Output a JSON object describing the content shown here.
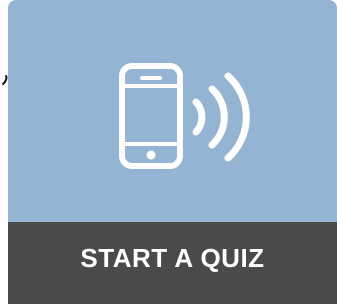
{
  "card": {
    "label": "START A QUIZ",
    "icon": "phone-signal-icon",
    "colors": {
      "top_background": "#93b5d3",
      "bottom_background": "#4a4a4a",
      "label_text": "#ffffff",
      "icon_stroke": "#ffffff"
    }
  }
}
